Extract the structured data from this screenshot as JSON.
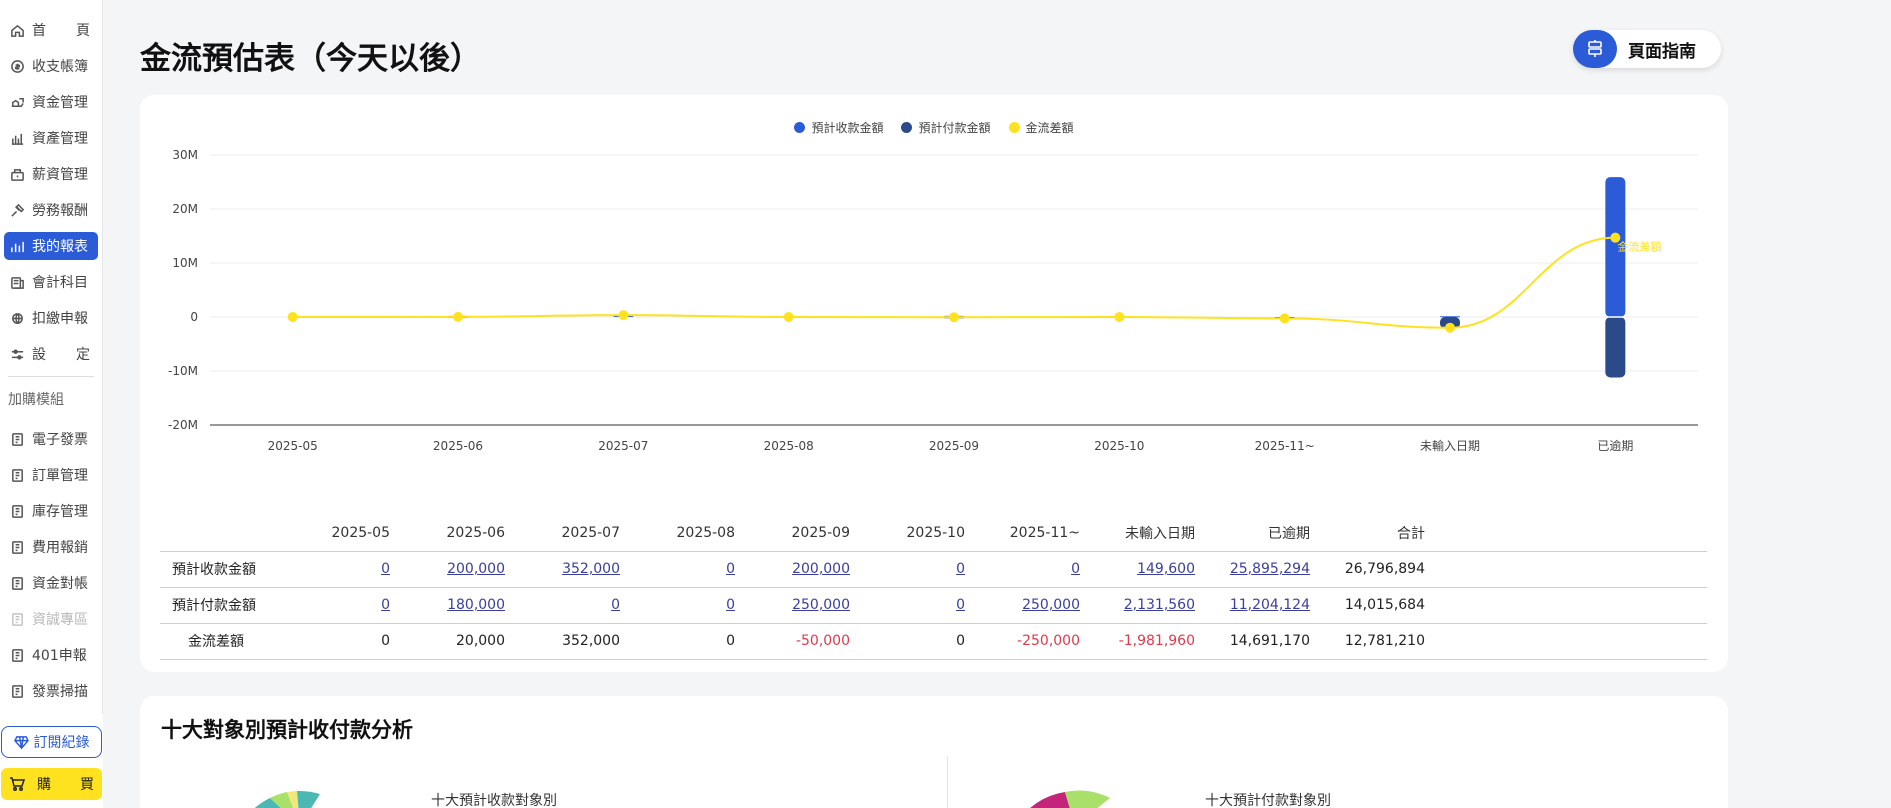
{
  "page": {
    "title": "金流預估表（今天以後）",
    "guide_label": "頁面指南"
  },
  "sidebar": {
    "items": [
      {
        "label": "首頁",
        "spread": [
          "首",
          "頁"
        ],
        "icon": "home-icon",
        "state": "normal"
      },
      {
        "label": "收支帳簿",
        "icon": "coin-icon",
        "state": "normal"
      },
      {
        "label": "資金管理",
        "icon": "fund-icon",
        "state": "normal"
      },
      {
        "label": "資產管理",
        "icon": "asset-icon",
        "state": "normal"
      },
      {
        "label": "薪資管理",
        "icon": "salary-icon",
        "state": "normal"
      },
      {
        "label": "勞務報酬",
        "icon": "labor-icon",
        "state": "normal"
      },
      {
        "label": "我的報表",
        "icon": "report-chart-icon",
        "state": "active"
      },
      {
        "label": "會計科目",
        "icon": "ledger-icon",
        "state": "normal"
      },
      {
        "label": "扣繳申報",
        "icon": "withholding-icon",
        "state": "normal"
      },
      {
        "label": "設定",
        "spread": [
          "設",
          "定"
        ],
        "icon": "settings-sliders-icon",
        "state": "normal"
      }
    ],
    "addon_section": "加購模組",
    "addon_items": [
      {
        "label": "電子發票",
        "icon": "doc-icon",
        "state": "normal"
      },
      {
        "label": "訂單管理",
        "icon": "doc-icon",
        "state": "normal"
      },
      {
        "label": "庫存管理",
        "icon": "doc-icon",
        "state": "normal"
      },
      {
        "label": "費用報銷",
        "icon": "doc-icon",
        "state": "normal"
      },
      {
        "label": "資金對帳",
        "icon": "doc-icon",
        "state": "normal"
      },
      {
        "label": "資誠專區",
        "icon": "doc-icon",
        "state": "disabled"
      },
      {
        "label": "401申報",
        "icon": "doc-icon",
        "state": "normal"
      },
      {
        "label": "發票掃描",
        "icon": "doc-icon",
        "state": "normal"
      }
    ],
    "subscription_label": "訂閱紀錄",
    "buy_label": [
      "購",
      "買"
    ]
  },
  "chart_data": {
    "type": "bar",
    "categories": [
      "2025-05",
      "2025-06",
      "2025-07",
      "2025-08",
      "2025-09",
      "2025-10",
      "2025-11~",
      "未輸入日期",
      "已逾期"
    ],
    "series": [
      {
        "name": "預計收款金額",
        "type": "bar",
        "color": "#2b5bd7",
        "values": [
          0,
          200000,
          352000,
          0,
          200000,
          0,
          0,
          149600,
          25895294
        ]
      },
      {
        "name": "預計付款金額",
        "type": "bar",
        "color": "#2a4a8a",
        "values": [
          0,
          -180000,
          0,
          0,
          -250000,
          0,
          -250000,
          -2131560,
          -11204124
        ]
      },
      {
        "name": "金流差額",
        "type": "line",
        "color": "#ffe21f",
        "values": [
          0,
          20000,
          352000,
          0,
          -50000,
          0,
          -250000,
          -1981960,
          14691170
        ]
      }
    ],
    "yticks": [
      "30M",
      "20M",
      "10M",
      "0",
      "-10M",
      "-20M"
    ],
    "ylim": [
      -20000000,
      30000000
    ],
    "legend_position": "top-center",
    "annotation": "金流差額",
    "grid": true
  },
  "table": {
    "headers": [
      "",
      "2025-05",
      "2025-06",
      "2025-07",
      "2025-08",
      "2025-09",
      "2025-10",
      "2025-11~",
      "未輸入日期",
      "已逾期",
      "合計"
    ],
    "rows": [
      {
        "label": "預計收款金額",
        "cells": [
          "0",
          "200,000",
          "352,000",
          "0",
          "200,000",
          "0",
          "0",
          "149,600",
          "25,895,294"
        ],
        "total": "26,796,894",
        "link": true,
        "neg": []
      },
      {
        "label": "預計付款金額",
        "cells": [
          "0",
          "180,000",
          "0",
          "0",
          "250,000",
          "0",
          "250,000",
          "2,131,560",
          "11,204,124"
        ],
        "total": "14,015,684",
        "link": true,
        "neg": []
      },
      {
        "label": "金流差額",
        "cells": [
          "0",
          "20,000",
          "352,000",
          "0",
          "-50,000",
          "0",
          "-250,000",
          "-1,981,960",
          "14,691,170"
        ],
        "total": "12,781,210",
        "link": false,
        "neg": [
          4,
          6,
          7
        ]
      }
    ]
  },
  "section2": {
    "title": "十大對象別預計收付款分析",
    "pie_receivable_title": "十大預計收款對象別",
    "pie_payable_title": "十大預計付款對象別"
  }
}
